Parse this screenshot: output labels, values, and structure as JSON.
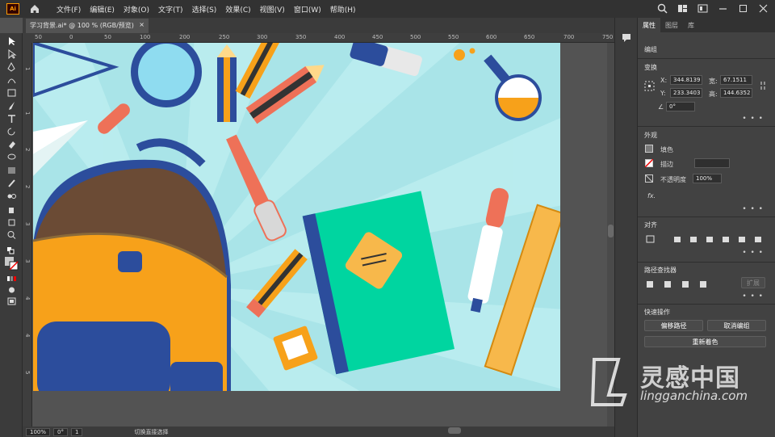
{
  "app": {
    "logo": "Ai"
  },
  "menu": [
    "文件(F)",
    "编辑(E)",
    "对象(O)",
    "文字(T)",
    "选择(S)",
    "效果(C)",
    "视图(V)",
    "窗口(W)",
    "帮助(H)"
  ],
  "document": {
    "tab_title": "学习背景.ai* @ 100 % (RGB/预览)",
    "close": "×"
  },
  "ruler_h": [
    "50",
    "0",
    "50",
    "100",
    "150",
    "200",
    "250",
    "300",
    "350",
    "400",
    "450",
    "500",
    "550",
    "600",
    "650",
    "700",
    "750"
  ],
  "ruler_v": [
    "0",
    "5",
    "0",
    "1",
    "0",
    "0",
    "1",
    "5",
    "0",
    "2",
    "0",
    "0",
    "2",
    "5",
    "0",
    "3",
    "0",
    "0",
    "3",
    "5",
    "0",
    "4",
    "0",
    "0",
    "4",
    "5",
    "0",
    "5",
    "0",
    "0"
  ],
  "status": {
    "zoom": "100%",
    "rotate": "0°",
    "page": "1",
    "mode": "切换直接选择"
  },
  "panel": {
    "tabs": [
      "属性",
      "图层",
      "库"
    ],
    "group": "编组",
    "transform": {
      "title": "变换",
      "x_label": "X:",
      "x": "344.8139",
      "y_label": "Y:",
      "y": "233.3403",
      "w_label": "宽:",
      "w": "67.1511",
      "h_label": "高:",
      "h": "144.6352",
      "angle": "0°"
    },
    "appearance": {
      "title": "外观",
      "fill": "填色",
      "stroke": "描边",
      "opacity_label": "不透明度",
      "opacity": "100%",
      "fx": "fx."
    },
    "align": {
      "title": "对齐"
    },
    "pathfinder": {
      "title": "路径查找器",
      "expand": "扩展"
    },
    "quick": {
      "title": "快速操作",
      "offset": "偏移路径",
      "ungroup": "取消编组",
      "recolor": "重新着色"
    },
    "more": "• • •"
  },
  "watermark": {
    "text": "灵感中国",
    "url": "lingganchina.com"
  },
  "colors": {
    "canvas": "#a9e4e8",
    "orange": "#f7a11a",
    "navy": "#2c4d9c",
    "teal": "#00d5a0",
    "salmon": "#ee7158",
    "brown": "#6b4b35"
  }
}
